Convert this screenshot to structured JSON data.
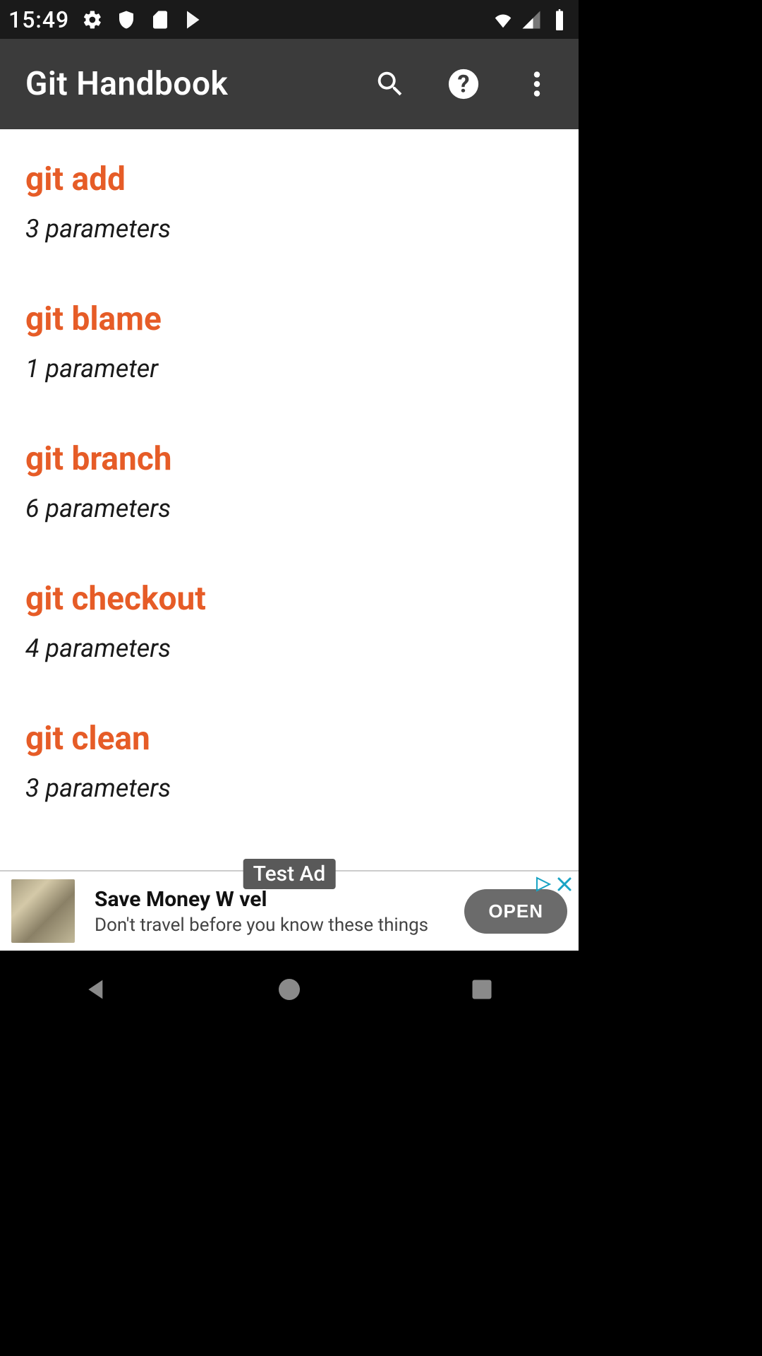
{
  "status": {
    "time": "15:49"
  },
  "appbar": {
    "title": "Git Handbook"
  },
  "commands": [
    {
      "name": "git add",
      "params": "3 parameters"
    },
    {
      "name": "git blame",
      "params": "1 parameter"
    },
    {
      "name": "git branch",
      "params": "6 parameters"
    },
    {
      "name": "git checkout",
      "params": "4 parameters"
    },
    {
      "name": "git clean",
      "params": "3 parameters"
    }
  ],
  "ad": {
    "label": "Test Ad",
    "title_visible": "Save Money W         vel",
    "subtitle": "Don't travel before you know these things",
    "button": "OPEN"
  }
}
